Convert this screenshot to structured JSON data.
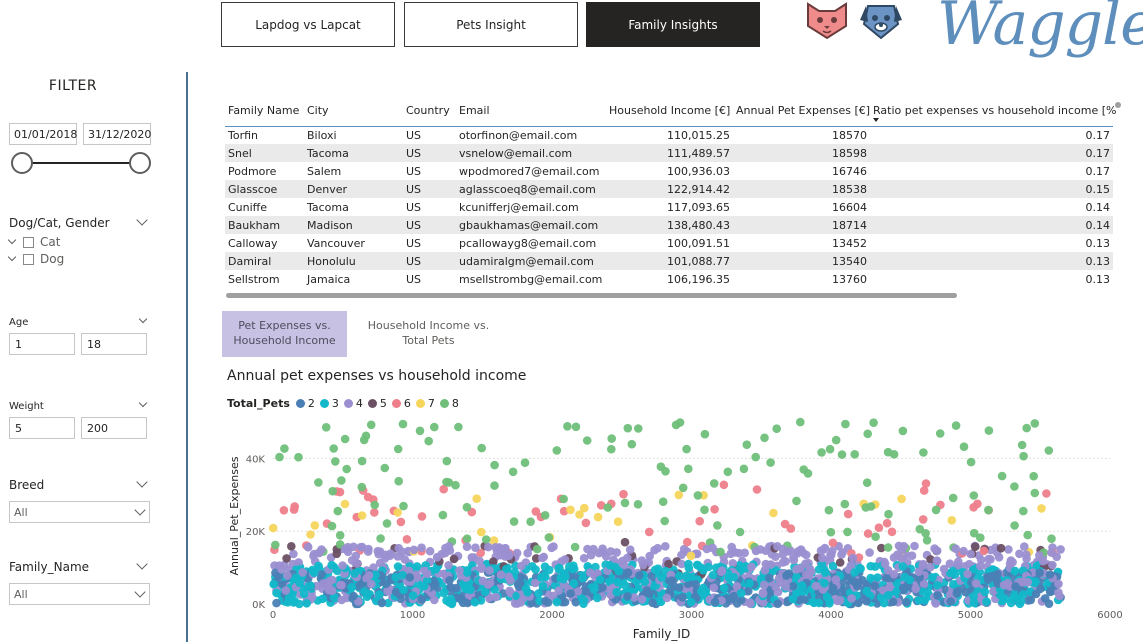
{
  "nav": {
    "tabs": [
      {
        "label": "Lapdog vs Lapcat",
        "active": false
      },
      {
        "label": "Pets Insight",
        "active": false
      },
      {
        "label": "Family Insights",
        "active": true
      }
    ]
  },
  "logo": {
    "text": "Waggle",
    "color": "#5d8ebc",
    "mascots": [
      "cat-face-icon",
      "dog-face-icon"
    ]
  },
  "filters": {
    "title": "FILTER",
    "date_start": "01/01/2018",
    "date_end": "31/12/2020",
    "gender": {
      "label": "Dog/Cat, Gender",
      "options": [
        "Cat",
        "Dog"
      ]
    },
    "age": {
      "label": "Age",
      "min": "1",
      "max": "18"
    },
    "weight": {
      "label": "Weight",
      "min": "5",
      "max": "200"
    },
    "breed": {
      "label": "Breed",
      "value": "All"
    },
    "family_name": {
      "label": "Family_Name",
      "value": "All"
    }
  },
  "table": {
    "columns": [
      "Family Name",
      "City",
      "Country",
      "Email",
      "Household Income [€]",
      "Annual Pet Expenses [€]",
      "Ratio pet expenses vs household income [%]"
    ],
    "rows": [
      [
        "Torfin",
        "Biloxi",
        "US",
        "otorfinon@email.com",
        "110,015.25",
        "18570",
        "0.17"
      ],
      [
        "Snel",
        "Tacoma",
        "US",
        "vsnelow@email.com",
        "111,489.57",
        "18598",
        "0.17"
      ],
      [
        "Podmore",
        "Salem",
        "US",
        "wpodmored7@email.com",
        "100,936.03",
        "16746",
        "0.17"
      ],
      [
        "Glasscoe",
        "Denver",
        "US",
        "aglasscoeq8@email.com",
        "122,914.42",
        "18538",
        "0.15"
      ],
      [
        "Cuniffe",
        "Tacoma",
        "US",
        "kcunifferj@email.com",
        "117,093.65",
        "16604",
        "0.14"
      ],
      [
        "Baukham",
        "Madison",
        "US",
        "gbaukhamas@email.com",
        "138,480.43",
        "18714",
        "0.14"
      ],
      [
        "Calloway",
        "Vancouver",
        "US",
        "pcallowayg8@email.com",
        "100,091.51",
        "13452",
        "0.13"
      ],
      [
        "Damiral",
        "Honolulu",
        "US",
        "udamiralgm@email.com",
        "101,088.77",
        "13540",
        "0.13"
      ],
      [
        "Sellstrom",
        "Jamaica",
        "US",
        "msellstrombg@email.com",
        "106,196.35",
        "13760",
        "0.13"
      ]
    ]
  },
  "chart_tabs": [
    {
      "label": "Pet Expenses vs.\nHousehold Income",
      "active": true
    },
    {
      "label": "Household Income vs.\nTotal Pets",
      "active": false
    }
  ],
  "chart_data": {
    "type": "scatter",
    "title": "Annual pet expenses vs household income",
    "xlabel": "Family_ID",
    "ylabel": "Annual_Pet_Expenses",
    "xlim": [
      0,
      6000
    ],
    "ylim": [
      0,
      50000
    ],
    "x_ticks": [
      "0",
      "1000",
      "2000",
      "3000",
      "4000",
      "5000",
      "6000"
    ],
    "y_ticks": [
      "0K",
      "20K",
      "40K"
    ],
    "x_ticks_values": [
      0,
      1000,
      2000,
      3000,
      4000,
      5000,
      6000
    ],
    "y_ticks_values": [
      0,
      20000,
      40000
    ],
    "grid": true,
    "legend_title": "Total_Pets",
    "legend_position": "top-left",
    "series": [
      {
        "name": "2",
        "color": "#4a7fb5",
        "x_range": [
          0,
          5650
        ],
        "y_range": [
          0,
          9000
        ]
      },
      {
        "name": "3",
        "color": "#12b8c9",
        "x_range": [
          0,
          5650
        ],
        "y_range": [
          0,
          11000
        ]
      },
      {
        "name": "4",
        "color": "#9b8fd1",
        "x_range": [
          0,
          5650
        ],
        "y_range": [
          0,
          16000
        ]
      },
      {
        "name": "5",
        "color": "#6b5064",
        "x_range": [
          0,
          5650
        ],
        "y_range": [
          8000,
          17000
        ]
      },
      {
        "name": "6",
        "color": "#ee7e8a",
        "x_range": [
          0,
          5650
        ],
        "y_range": [
          12000,
          34000
        ]
      },
      {
        "name": "7",
        "color": "#f6d55c",
        "x_range": [
          0,
          5650
        ],
        "y_range": [
          13000,
          30000
        ]
      },
      {
        "name": "8",
        "color": "#6fbf7a",
        "x_range": [
          0,
          5650
        ],
        "y_range": [
          14000,
          50000
        ]
      }
    ]
  }
}
